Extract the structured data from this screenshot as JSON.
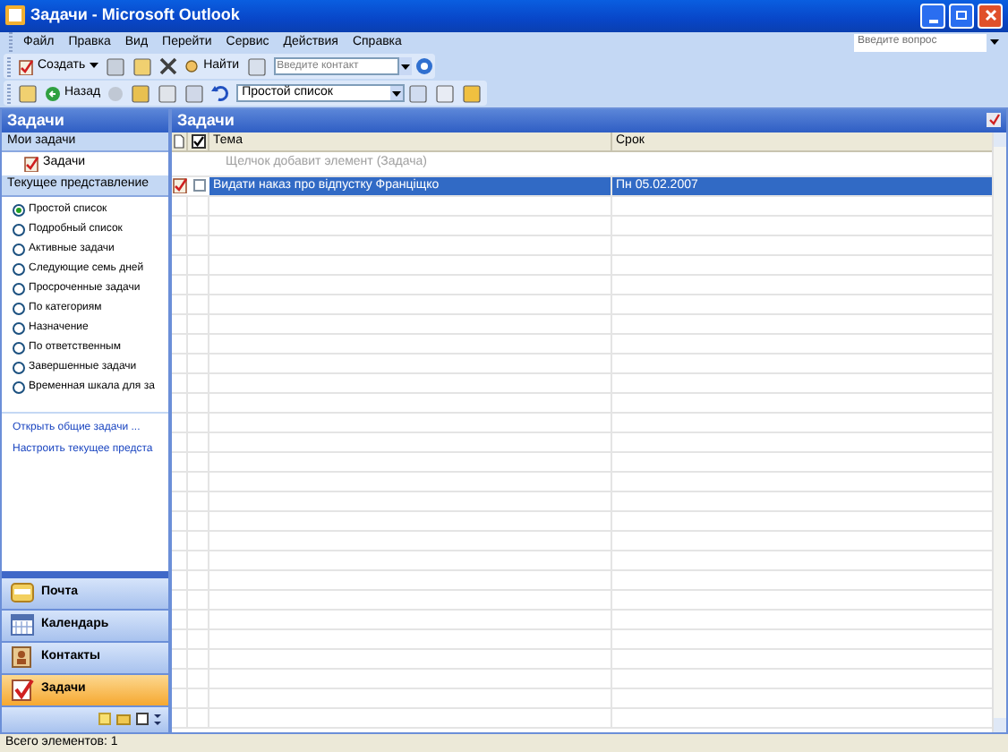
{
  "window": {
    "title": "Задачи - Microsoft Outlook"
  },
  "menu": [
    "Файл",
    "Правка",
    "Вид",
    "Перейти",
    "Сервис",
    "Действия",
    "Справка"
  ],
  "help_search": {
    "placeholder": "Введите вопрос"
  },
  "toolbar1": {
    "new_label": "Создать",
    "find_label": "Найти",
    "contact_field": {
      "placeholder": "Введите контакт"
    }
  },
  "toolbar2": {
    "back_label": "Назад",
    "view_select": {
      "value": "Простой список"
    }
  },
  "nav_pane": {
    "title": "Задачи",
    "my_tasks_header": "Мои задачи",
    "my_tasks": [
      {
        "label": "Задачи"
      }
    ],
    "views_header": "Текущее представление",
    "views": [
      {
        "label": "Простой список",
        "selected": true
      },
      {
        "label": "Подробный список",
        "selected": false
      },
      {
        "label": "Активные задачи",
        "selected": false
      },
      {
        "label": "Следующие семь дней",
        "selected": false
      },
      {
        "label": "Просроченные задачи",
        "selected": false
      },
      {
        "label": "По категориям",
        "selected": false
      },
      {
        "label": "Назначение",
        "selected": false
      },
      {
        "label": "По ответственным",
        "selected": false
      },
      {
        "label": "Завершенные задачи",
        "selected": false
      },
      {
        "label": "Временная шкала для за",
        "selected": false
      }
    ],
    "links": [
      "Открыть общие задачи ...",
      "Настроить текущее предста"
    ]
  },
  "nav_buttons": [
    {
      "label": "Почта",
      "kind": "mail",
      "selected": false
    },
    {
      "label": "Календарь",
      "kind": "calendar",
      "selected": false
    },
    {
      "label": "Контакты",
      "kind": "contacts",
      "selected": false
    },
    {
      "label": "Задачи",
      "kind": "tasks",
      "selected": true
    }
  ],
  "content": {
    "title": "Задачи",
    "columns": [
      "Тема",
      "Срок"
    ],
    "add_placeholder": "Щелчок добавит элемент (Задача)",
    "rows": [
      {
        "subject": "Видати наказ про відпустку Франціщко",
        "due": "Пн 05.02.2007",
        "selected": true,
        "checked": false
      }
    ]
  },
  "status_bar": {
    "text": "Всего элементов: 1"
  }
}
